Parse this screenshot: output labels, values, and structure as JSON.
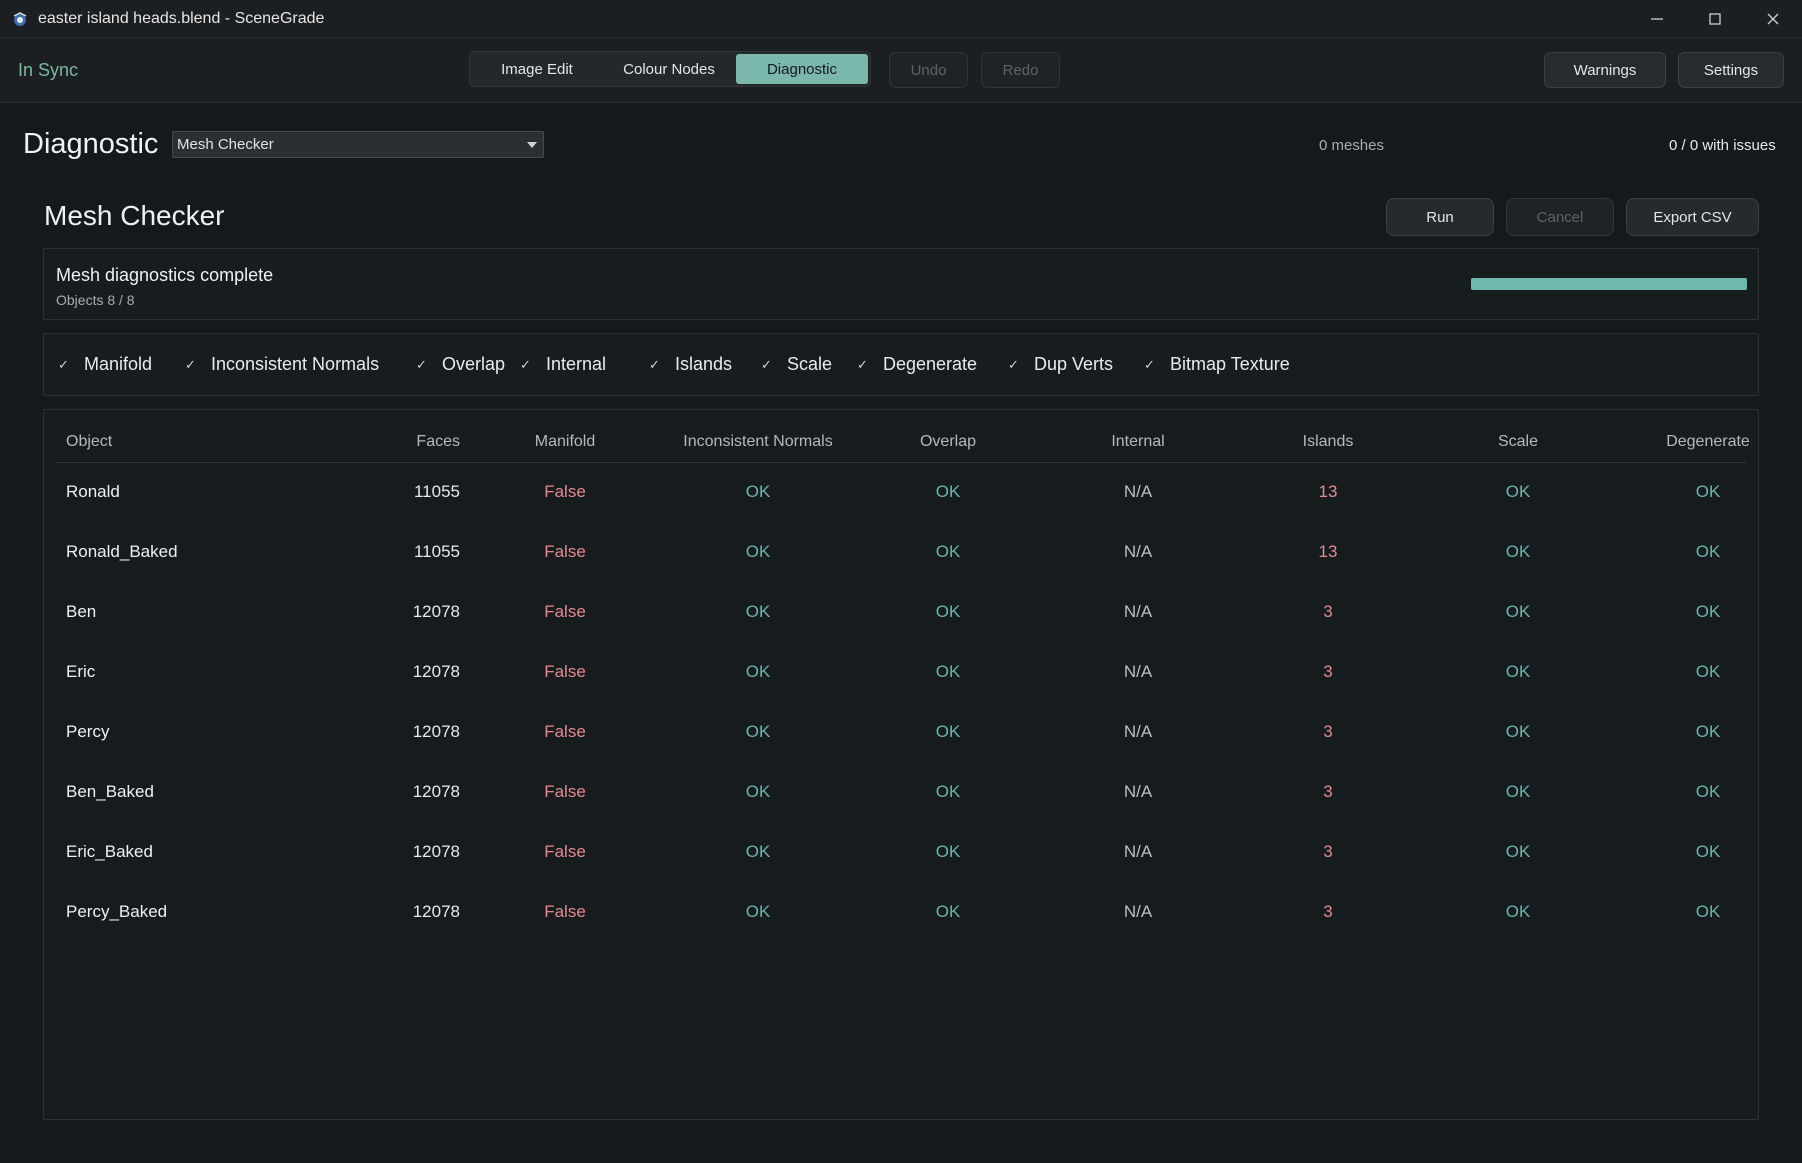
{
  "window": {
    "title": "easter island heads.blend - SceneGrade"
  },
  "toolbar": {
    "sync_status": "In Sync",
    "modes": [
      "Image Edit",
      "Colour Nodes",
      "Diagnostic"
    ],
    "active_mode": "Diagnostic",
    "undo": "Undo",
    "redo": "Redo",
    "warnings": "Warnings",
    "settings": "Settings"
  },
  "header": {
    "title": "Diagnostic",
    "tool_select": "Mesh Checker",
    "mesh_count": "0 meshes",
    "issues": "0 / 0 with issues"
  },
  "panel": {
    "title": "Mesh Checker",
    "run": "Run",
    "cancel": "Cancel",
    "export": "Export CSV"
  },
  "status": {
    "message": "Mesh diagnostics complete",
    "objects": "Objects 8 / 8",
    "progress": 1.0
  },
  "checks": [
    {
      "label": "Manifold",
      "checked": true
    },
    {
      "label": "Inconsistent Normals",
      "checked": true
    },
    {
      "label": "Overlap",
      "checked": true
    },
    {
      "label": "Internal",
      "checked": true
    },
    {
      "label": "Islands",
      "checked": true
    },
    {
      "label": "Scale",
      "checked": true
    },
    {
      "label": "Degenerate",
      "checked": true
    },
    {
      "label": "Dup Verts",
      "checked": true
    },
    {
      "label": "Bitmap Texture",
      "checked": true
    }
  ],
  "check_mark": "✓",
  "table": {
    "columns": [
      "Object",
      "Faces",
      "Manifold",
      "Inconsistent Normals",
      "Overlap",
      "Internal",
      "Islands",
      "Scale",
      "Degenerate"
    ],
    "rows": [
      [
        "Ronald",
        "11055",
        "False",
        "OK",
        "OK",
        "N/A",
        "13",
        "OK",
        "OK"
      ],
      [
        "Ronald_Baked",
        "11055",
        "False",
        "OK",
        "OK",
        "N/A",
        "13",
        "OK",
        "OK"
      ],
      [
        "Ben",
        "12078",
        "False",
        "OK",
        "OK",
        "N/A",
        "3",
        "OK",
        "OK"
      ],
      [
        "Eric",
        "12078",
        "False",
        "OK",
        "OK",
        "N/A",
        "3",
        "OK",
        "OK"
      ],
      [
        "Percy",
        "12078",
        "False",
        "OK",
        "OK",
        "N/A",
        "3",
        "OK",
        "OK"
      ],
      [
        "Ben_Baked",
        "12078",
        "False",
        "OK",
        "OK",
        "N/A",
        "3",
        "OK",
        "OK"
      ],
      [
        "Eric_Baked",
        "12078",
        "False",
        "OK",
        "OK",
        "N/A",
        "3",
        "OK",
        "OK"
      ],
      [
        "Percy_Baked",
        "12078",
        "False",
        "OK",
        "OK",
        "N/A",
        "3",
        "OK",
        "OK"
      ]
    ]
  },
  "colors": {
    "accent": "#7ab8ad",
    "ok": "#6bb5ac",
    "error": "#e58a8f",
    "sync": "#7ab9a2"
  }
}
